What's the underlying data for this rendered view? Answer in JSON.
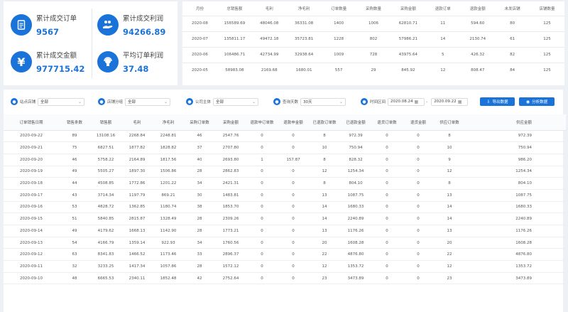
{
  "stats": [
    {
      "label": "累计成交订单",
      "value": "9567",
      "icon": "document-icon"
    },
    {
      "label": "累计成交利润",
      "value": "94266.89",
      "icon": "hand-coins-icon"
    },
    {
      "label": "累计成交金额",
      "value": "977715.42",
      "icon": "yen-icon"
    },
    {
      "label": "平均订单利润",
      "value": "37.48",
      "icon": "person-headset-icon"
    }
  ],
  "monthly": {
    "headers": [
      "月份",
      "总销售额",
      "毛利",
      "净毛利",
      "订单数量",
      "采购数量",
      "采购金额",
      "退款订单",
      "退款金额",
      "未发店铺",
      "店铺数量"
    ],
    "rows": [
      [
        "2020-08",
        "156589.69",
        "48046.08",
        "36331.08",
        "1400",
        "1006",
        "62810.71",
        "11",
        "594.60",
        "80",
        "125"
      ],
      [
        "2020-07",
        "135811.17",
        "49472.18",
        "35723.81",
        "1228",
        "802",
        "57986.21",
        "14",
        "2130.74",
        "61",
        "125"
      ],
      [
        "2020-06",
        "106486.71",
        "42734.99",
        "32938.64",
        "1009",
        "728",
        "43975.64",
        "5",
        "426.32",
        "82",
        "125"
      ],
      [
        "2020-05",
        "58983.08",
        "2169.68",
        "1680.01",
        "557",
        "29",
        "845.92",
        "12",
        "808.47",
        "84",
        "125"
      ]
    ]
  },
  "filters": {
    "store": {
      "label": "站点店铺",
      "value": "全部"
    },
    "category": {
      "label": "店铺分组",
      "value": "全部"
    },
    "company": {
      "label": "公司主体",
      "value": "全部"
    },
    "range": {
      "label": "查询天数",
      "value": "30天"
    },
    "date": {
      "label": "时间区间",
      "start": "2020.08.24",
      "end": "2020.09.22"
    },
    "export_label": "导出数据",
    "analyze_label": "分析数据"
  },
  "detail": {
    "headers": [
      "订单销售日期",
      "销售条数",
      "销售额",
      "毛利",
      "净毛利",
      "采购订单数",
      "采购金额",
      "退款申订单数",
      "退款申金额",
      "已退款订单数",
      "已退款金额",
      "退货订单数",
      "退货金额",
      "供应订单数",
      "供应金额"
    ],
    "rows": [
      [
        "2020-09-22",
        "89",
        "13108.16",
        "2268.84",
        "2248.81",
        "46",
        "2547.76",
        "0",
        "0",
        "8",
        "972.39",
        "0",
        "0",
        "8",
        "972.39"
      ],
      [
        "2020-09-21",
        "75",
        "6827.51",
        "1877.82",
        "1828.82",
        "37",
        "2707.80",
        "0",
        "0",
        "10",
        "750.94",
        "0",
        "0",
        "10",
        "750.94"
      ],
      [
        "2020-09-20",
        "46",
        "5758.22",
        "2164.89",
        "1817.56",
        "40",
        "2693.80",
        "1",
        "157.87",
        "8",
        "828.32",
        "0",
        "0",
        "9",
        "986.20"
      ],
      [
        "2020-09-19",
        "49",
        "5505.27",
        "1897.30",
        "1506.86",
        "28",
        "2862.83",
        "0",
        "0",
        "12",
        "1254.34",
        "0",
        "0",
        "12",
        "1254.34"
      ],
      [
        "2020-09-18",
        "44",
        "4508.85",
        "1772.86",
        "1201.22",
        "34",
        "2421.31",
        "0",
        "0",
        "8",
        "804.10",
        "0",
        "0",
        "8",
        "804.10"
      ],
      [
        "2020-09-17",
        "43",
        "3714.34",
        "1197.79",
        "869.21",
        "30",
        "1483.81",
        "0",
        "0",
        "13",
        "1087.75",
        "0",
        "0",
        "13",
        "1087.75"
      ],
      [
        "2020-09-16",
        "53",
        "4828.72",
        "1362.85",
        "1180.74",
        "38",
        "1853.70",
        "0",
        "0",
        "14",
        "1680.33",
        "0",
        "0",
        "14",
        "1680.33"
      ],
      [
        "2020-09-15",
        "51",
        "5840.85",
        "2815.87",
        "1328.49",
        "28",
        "2309.26",
        "0",
        "0",
        "14",
        "2240.89",
        "0",
        "0",
        "14",
        "2240.89"
      ],
      [
        "2020-09-14",
        "49",
        "4179.62",
        "1668.13",
        "1142.90",
        "28",
        "1773.21",
        "0",
        "0",
        "13",
        "1176.26",
        "0",
        "0",
        "13",
        "1176.26"
      ],
      [
        "2020-09-13",
        "54",
        "4166.79",
        "1359.14",
        "922.93",
        "34",
        "1760.56",
        "0",
        "0",
        "20",
        "1608.28",
        "0",
        "0",
        "20",
        "1608.28"
      ],
      [
        "2020-09-12",
        "63",
        "8341.83",
        "1466.52",
        "1173.46",
        "33",
        "2896.37",
        "0",
        "0",
        "22",
        "4876.80",
        "0",
        "0",
        "22",
        "4876.80"
      ],
      [
        "2020-09-11",
        "32",
        "3233.25",
        "1417.34",
        "1057.86",
        "28",
        "1572.12",
        "0",
        "0",
        "12",
        "1353.72",
        "0",
        "0",
        "12",
        "1353.72"
      ],
      [
        "2020-09-10",
        "48",
        "6665.53",
        "2340.11",
        "1852.48",
        "42",
        "2752.64",
        "0",
        "0",
        "23",
        "3473.89",
        "0",
        "0",
        "23",
        "3473.89"
      ]
    ]
  }
}
